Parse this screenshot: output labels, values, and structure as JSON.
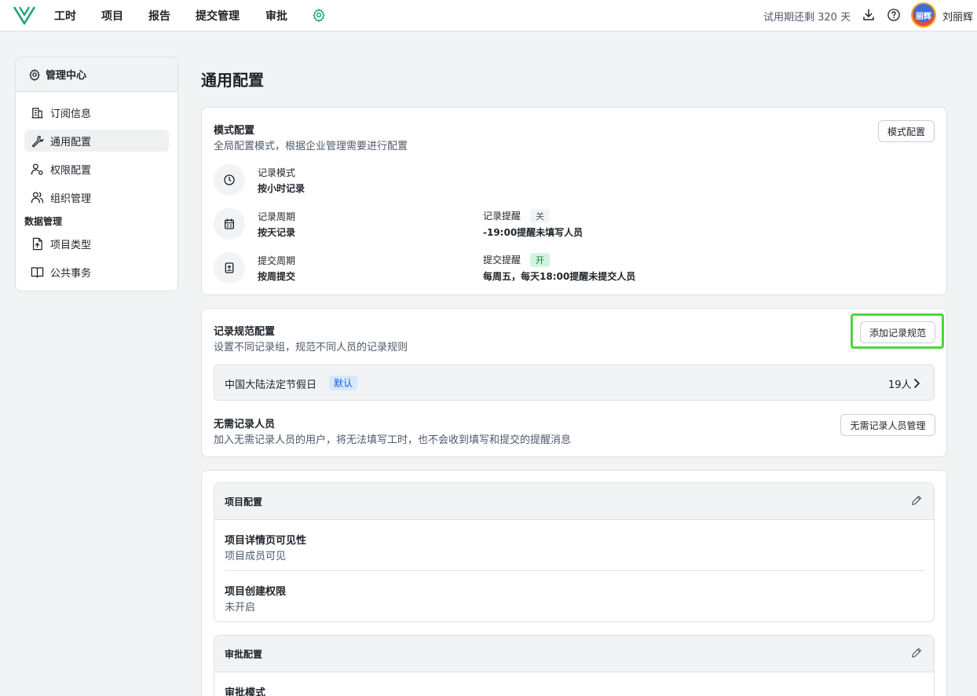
{
  "topnav": {
    "items": [
      "工时",
      "项目",
      "报告",
      "提交管理",
      "审批"
    ],
    "trial": "试用期还剩 320 天",
    "user_name": "刘丽辉",
    "avatar_text": "丽辉"
  },
  "sidebar": {
    "title": "管理中心",
    "items": [
      {
        "label": "订阅信息",
        "icon": "building-icon"
      },
      {
        "label": "通用配置",
        "icon": "wrench-icon",
        "active": true
      },
      {
        "label": "权限配置",
        "icon": "user-key-icon"
      },
      {
        "label": "组织管理",
        "icon": "users-icon"
      }
    ],
    "group_label": "数据管理",
    "group_items": [
      {
        "label": "项目类型",
        "icon": "file-upload-icon"
      },
      {
        "label": "公共事务",
        "icon": "book-icon"
      }
    ]
  },
  "main": {
    "title": "通用配置",
    "mode_card": {
      "title": "模式配置",
      "desc": "全局配置模式，根据企业管理需要进行配置",
      "button": "模式配置",
      "rows": [
        {
          "label": "记录模式",
          "value": "按小时记录"
        },
        {
          "label": "记录周期",
          "value": "按天记录",
          "extra_label": "记录提醒",
          "extra_tag": "关",
          "extra_value": "-19:00提醒未填写人员"
        },
        {
          "label": "提交周期",
          "value": "按周提交",
          "extra_label": "提交提醒",
          "extra_tag": "开",
          "extra_value": "每周五，每天18:00提醒未提交人员"
        }
      ]
    },
    "rule_card": {
      "title": "记录规范配置",
      "desc": "设置不同记录组，规范不同人员的记录规则",
      "button": "添加记录规范",
      "rule_name": "中国大陆法定节假日",
      "rule_tag": "默认",
      "rule_count": "19人",
      "exempt_title": "无需记录人员",
      "exempt_desc": "加入无需记录人员的用户，将无法填写工时，也不会收到填写和提交的提醒消息",
      "exempt_button": "无需记录人员管理"
    },
    "project_config": {
      "title": "项目配置",
      "fields": [
        {
          "label": "项目详情页可见性",
          "value": "项目成员可见"
        },
        {
          "label": "项目创建权限",
          "value": "未开启"
        }
      ]
    },
    "approval_config": {
      "title": "审批配置",
      "fields": [
        {
          "label": "审批模式"
        }
      ]
    }
  }
}
